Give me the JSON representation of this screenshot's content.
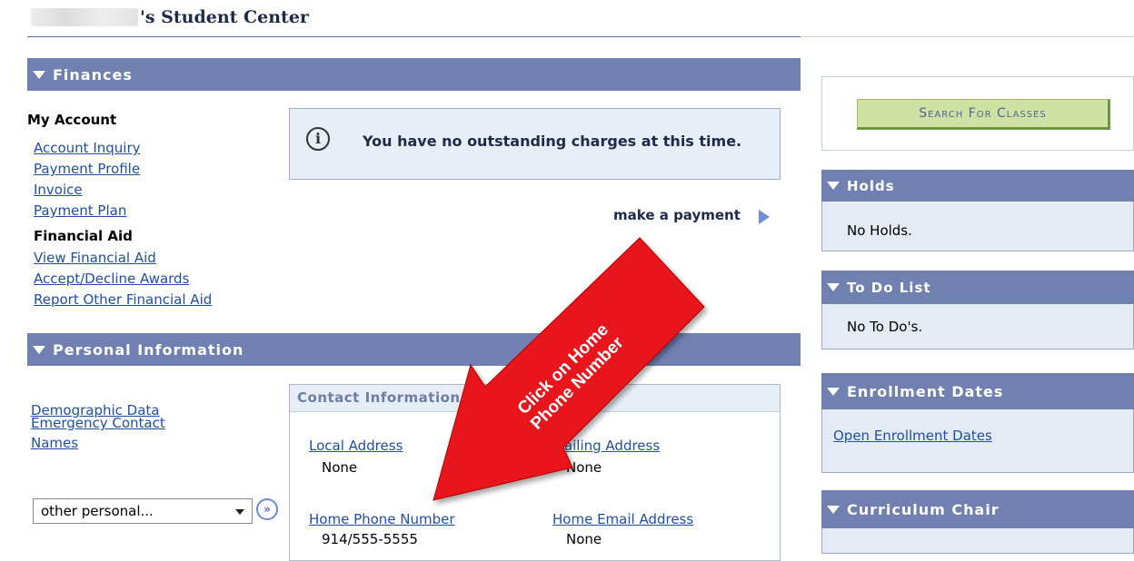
{
  "page": {
    "title": "'s Student Center"
  },
  "finances": {
    "header": "Finances",
    "my_account_label": "My Account",
    "account_links": [
      "Account Inquiry",
      "Payment Profile",
      "Invoice",
      "Payment Plan"
    ],
    "financial_aid_label": "Financial Aid",
    "aid_links": [
      "View Financial Aid",
      "Accept/Decline Awards",
      "Report Other Financial Aid"
    ],
    "notice": "You have no outstanding charges at this time.",
    "make_payment": "make a payment"
  },
  "personal": {
    "header": "Personal Information",
    "links": [
      "Demographic Data",
      "Emergency Contact",
      "Names"
    ],
    "contact": {
      "header": "Contact Information",
      "local_address_label": "Local Address",
      "local_address_value": "None",
      "mailing_address_label": "Mailing Address",
      "mailing_address_value": "None",
      "home_phone_label": "Home Phone Number",
      "home_phone_value": "914/555-5555",
      "home_email_label": "Home Email Address",
      "home_email_value": "None"
    },
    "dropdown_value": "other personal..."
  },
  "annotation": {
    "line1": "Click on Home",
    "line2": "Phone Number",
    "color": "#e8141a"
  },
  "sidebar": {
    "search_button": "Search For Classes",
    "holds_header": "Holds",
    "holds_text": "No Holds.",
    "todo_header": "To Do List",
    "todo_text": "No To Do's.",
    "enrollment_header": "Enrollment Dates",
    "enrollment_link": "Open Enrollment Dates",
    "curriculum_header": "Curriculum Chair"
  },
  "colors": {
    "header_bg": "#7080b0",
    "link": "#1f4fa5",
    "search_button_bg": "#cfe2a4"
  }
}
